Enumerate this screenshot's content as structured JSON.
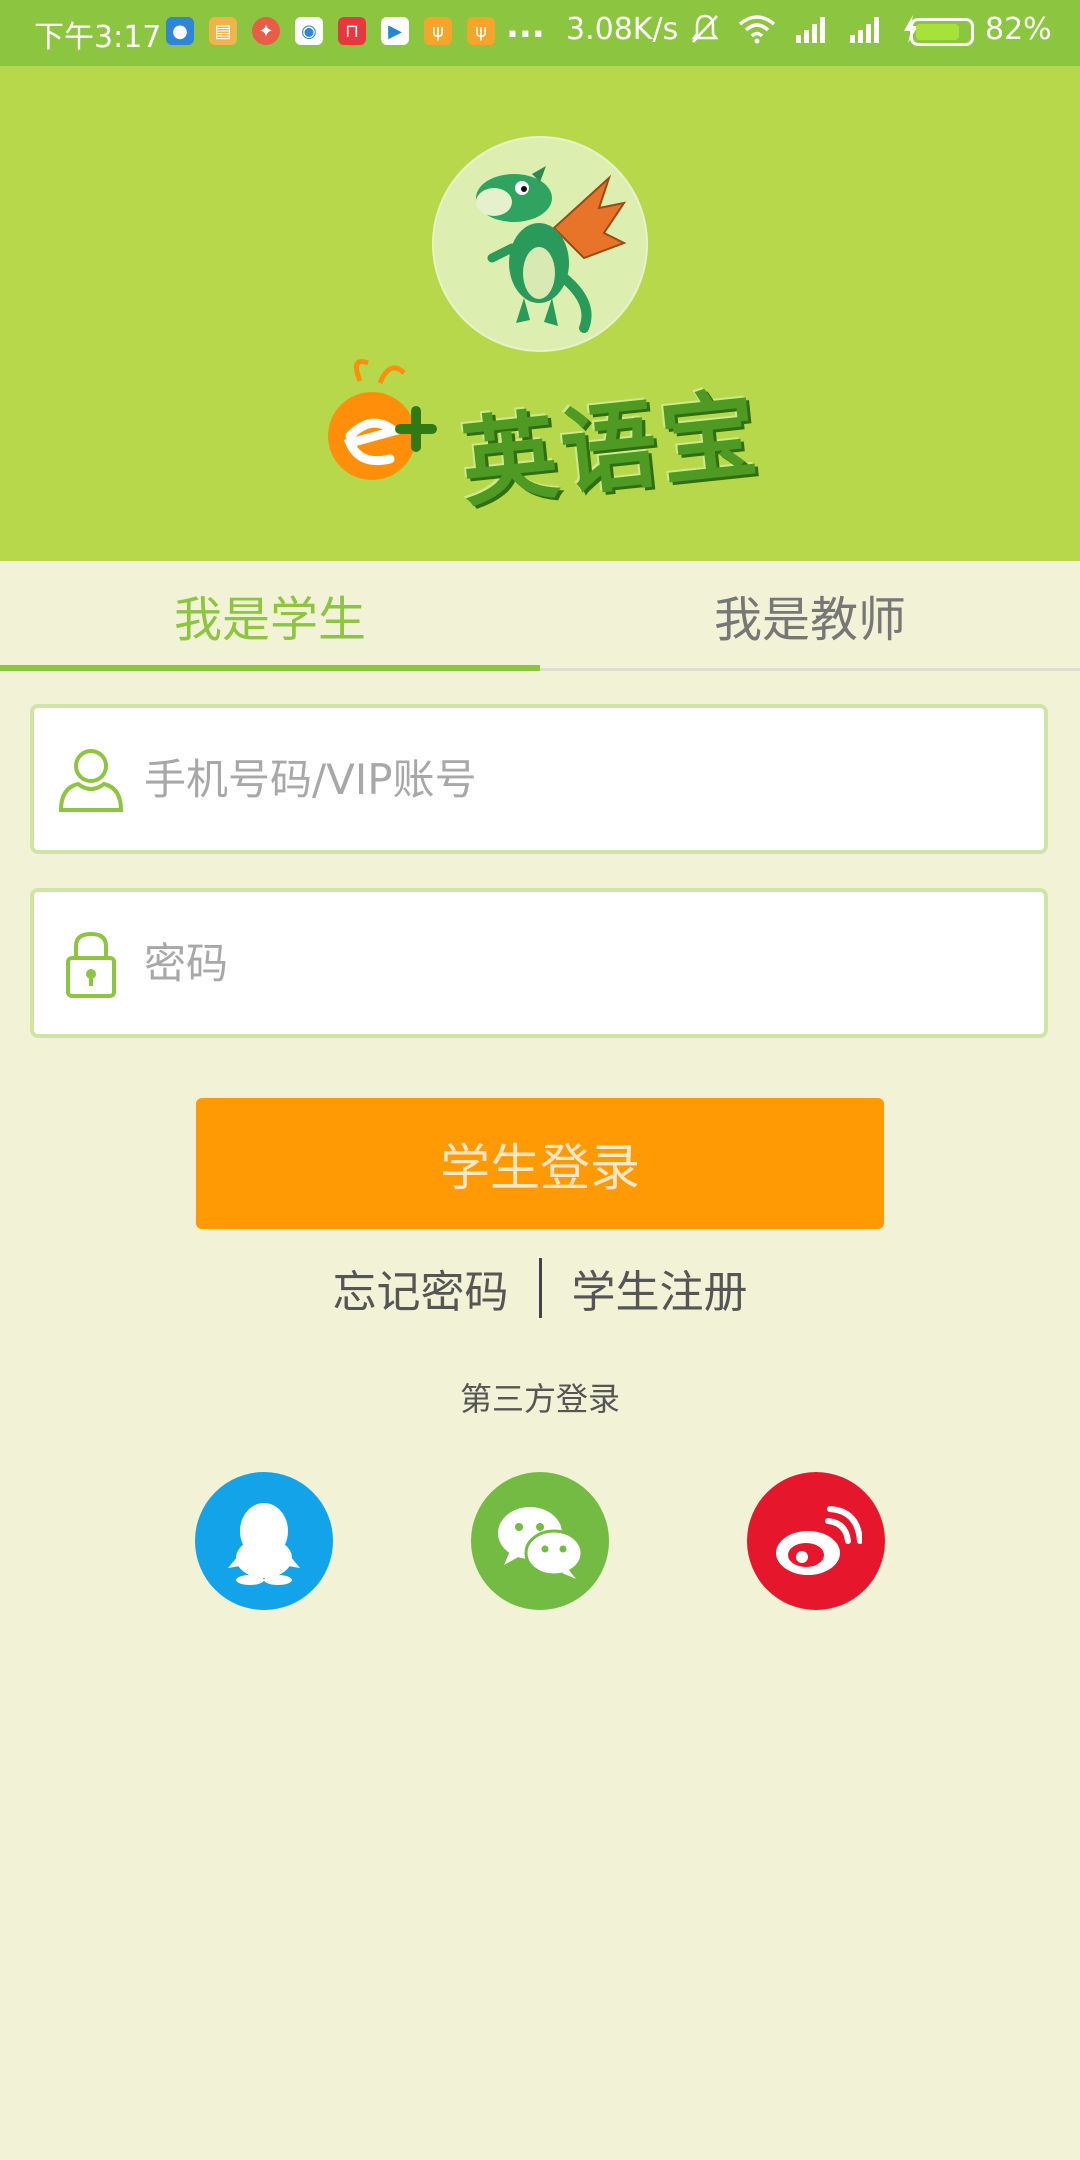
{
  "status_bar": {
    "time": "下午3:17",
    "more": "...",
    "net_speed": "3.08K/s",
    "battery": "82%",
    "battery_level": 0.82
  },
  "app": {
    "logo_text": "英语宝",
    "logo_prefix": "e+"
  },
  "tabs": [
    {
      "label": "我是学生",
      "active": true
    },
    {
      "label": "我是教师",
      "active": false
    }
  ],
  "form": {
    "username_placeholder": "手机号码/VIP账号",
    "password_placeholder": "密码",
    "login_button": "学生登录"
  },
  "links": {
    "forgot": "忘记密码",
    "register": "学生注册"
  },
  "third_party": {
    "title": "第三方登录",
    "providers": [
      {
        "name": "qq-icon",
        "color": "#12a3e8"
      },
      {
        "name": "wechat-icon",
        "color": "#73bb43"
      },
      {
        "name": "weibo-icon",
        "color": "#e6162d"
      }
    ]
  },
  "colors": {
    "accent_green": "#8cc540",
    "header_green": "#b6d84a",
    "button_orange": "#ff9a05",
    "background": "#f1f2d6"
  }
}
